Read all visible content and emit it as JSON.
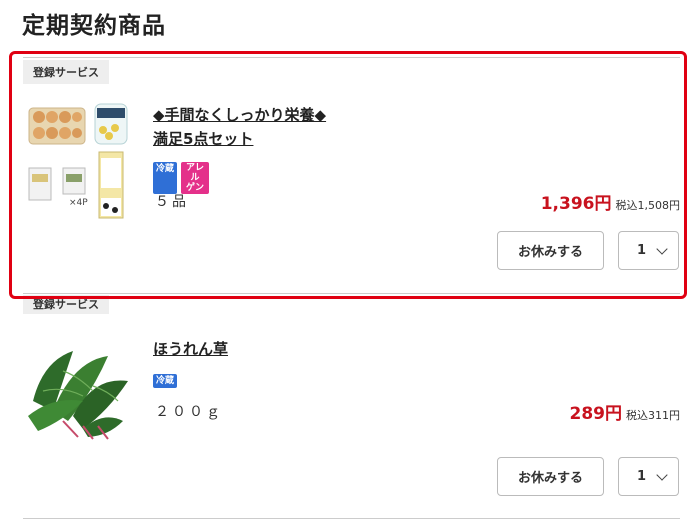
{
  "page_title": "定期契約商品",
  "items": [
    {
      "category": "登録サービス",
      "name": "◆手間なくしっかり栄養◆満足5点セット",
      "name_line1": "◆手間なくしっかり栄養◆",
      "name_line2": "満足5点セット",
      "badges": [
        "冷蔵",
        "アレルゲン"
      ],
      "badge_allergen_l1": "アレル",
      "badge_allergen_l2": "ゲン",
      "quantity_text": "５品",
      "price": "1,396円",
      "price_tax": "税込1,508円",
      "thumb_note": "×4P",
      "skip_label": "お休みする",
      "qty_value": "1"
    },
    {
      "category": "登録サービス",
      "name": "ほうれん草",
      "badges": [
        "冷蔵"
      ],
      "quantity_text": "２００ｇ",
      "price": "289円",
      "price_tax": "税込311円",
      "skip_label": "お休みする",
      "qty_value": "1"
    }
  ],
  "colors": {
    "highlight": "#e00012",
    "price": "#c8121e",
    "badge_cold": "#2f6fd6",
    "badge_allergen": "#e4308a"
  }
}
